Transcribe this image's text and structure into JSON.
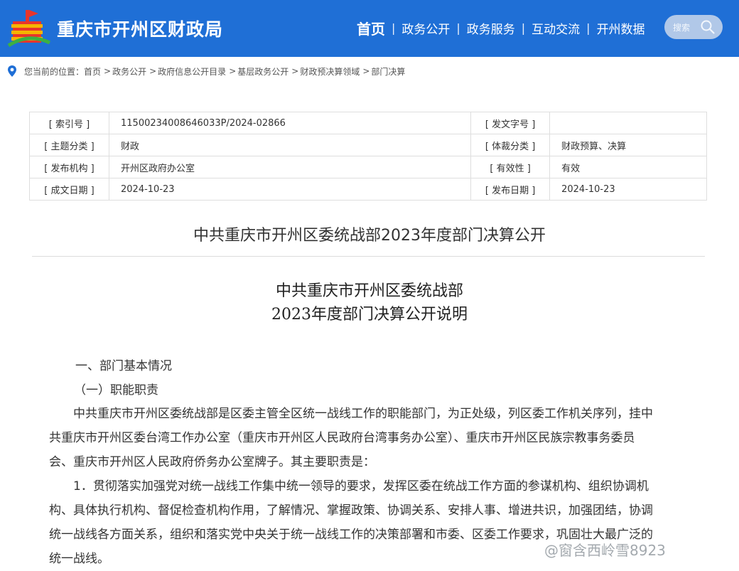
{
  "header": {
    "site_title": "重庆市开州区财政局",
    "nav": [
      {
        "label": "首页",
        "active": true
      },
      {
        "label": "政务公开",
        "active": false
      },
      {
        "label": "政务服务",
        "active": false
      },
      {
        "label": "互动交流",
        "active": false
      },
      {
        "label": "开州数据",
        "active": false
      }
    ],
    "search_placeholder": "搜索",
    "accent": "#1f6fd6"
  },
  "breadcrumb": {
    "prefix": "您当前的位置：",
    "items": [
      "首页",
      "政务公开",
      "政府信息公开目录",
      "基层政务公开",
      "财政预决算领域",
      "部门决算"
    ],
    "separator": ">"
  },
  "meta": {
    "rows": [
      {
        "k1": "[ 索引号 ]",
        "v1": "11500234008646033P/2024-02866",
        "k2": "[ 发文字号 ]",
        "v2": ""
      },
      {
        "k1": "[ 主题分类 ]",
        "v1": "财政",
        "k2": "[ 体裁分类 ]",
        "v2": "财政预算、决算"
      },
      {
        "k1": "[ 发布机构 ]",
        "v1": "开州区政府办公室",
        "k2": "[ 有效性 ]",
        "v2": "有效"
      },
      {
        "k1": "[ 成文日期 ]",
        "v1": "2024-10-23",
        "k2": "[ 发布日期 ]",
        "v2": "2024-10-23"
      }
    ]
  },
  "article": {
    "title": "中共重庆市开州区委统战部2023年度部门决算公开",
    "subtitle_line1": "中共重庆市开州区委统战部",
    "subtitle_line2": "2023年度部门决算公开说明",
    "section1": "一、部门基本情况",
    "section1_1": "（一）职能职责",
    "body_lines": [
      "　　中共重庆市开州区委统战部是区委主管全区统一战线工作的职能部门，为正处级，列区委工作机关序列，挂中",
      "共重庆市开州区委台湾工作办公室（重庆市开州区人民政府台湾事务办公室）、重庆市开州区民族宗教事务委员",
      "会、重庆市开州区人民政府侨务办公室牌子。其主要职责是：",
      "　　1．贯彻落实加强党对统一战线工作集中统一领导的要求，发挥区委在统战工作方面的参谋机构、组织协调机",
      "构、具体执行机构、督促检查机构作用，了解情况、掌握政策、协调关系、安排人事、增进共识，加强团结，协调",
      "统一战线各方面关系，组织和落实党中央关于统一战线工作的决策部署和市委、区委工作要求，巩固壮大最广泛的",
      "统一战线。"
    ]
  },
  "watermark": "@窗含西岭雪8923"
}
